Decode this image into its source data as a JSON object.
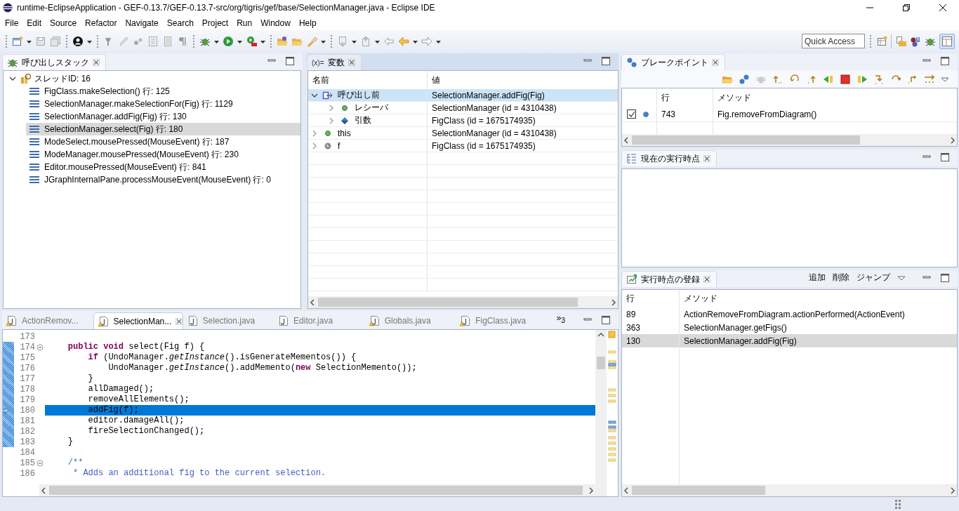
{
  "window": {
    "title": "runtime-EclipseApplication - GEF-0.13.7/GEF-0.13.7-src/org/tigris/gef/base/SelectionManager.java - Eclipse IDE"
  },
  "menu": [
    "File",
    "Edit",
    "Source",
    "Refactor",
    "Navigate",
    "Search",
    "Project",
    "Run",
    "Window",
    "Help"
  ],
  "quick_access": {
    "placeholder": "Quick Access"
  },
  "callstack": {
    "title": "呼び出しスタック",
    "active": false,
    "thread": {
      "label": "スレッドID: 16",
      "expanded": true,
      "frames": [
        {
          "label": "FigClass.makeSelection() 行: 125",
          "selected": false
        },
        {
          "label": "SelectionManager.makeSelectionFor(Fig) 行: 1129",
          "selected": false
        },
        {
          "label": "SelectionManager.addFig(Fig) 行: 130",
          "selected": false
        },
        {
          "label": "SelectionManager.select(Fig) 行: 180",
          "selected": true
        },
        {
          "label": "ModeSelect.mousePressed(MouseEvent) 行: 187",
          "selected": false
        },
        {
          "label": "ModeManager.mousePressed(MouseEvent) 行: 230",
          "selected": false
        },
        {
          "label": "Editor.mousePressed(MouseEvent) 行: 841",
          "selected": false
        },
        {
          "label": "JGraphInternalPane.processMouseEvent(MouseEvent) 行: 0",
          "selected": false
        }
      ]
    }
  },
  "variables": {
    "title": "変数",
    "icon_text": "(x)=",
    "active": true,
    "columns": [
      "名前",
      "値"
    ],
    "rows": [
      {
        "kind": "frame",
        "name": "呼び出し前",
        "value": "SelectionManager.addFig(Fig)",
        "expanded": true,
        "selected": true,
        "children": [
          {
            "kind": "field",
            "name": "レシーバ",
            "value": "SelectionManager (id = 4310438)",
            "expanded": false,
            "selected": false
          },
          {
            "kind": "argument",
            "name": "引数",
            "value": "FigClass (id = 1675174935)",
            "expanded": false,
            "selected": false
          }
        ]
      },
      {
        "kind": "field",
        "name": "this",
        "value": "SelectionManager (id = 4310438)",
        "expanded": false,
        "selected": false
      },
      {
        "kind": "local",
        "name": "f",
        "value": "FigClass (id = 1675174935)",
        "expanded": false,
        "selected": false
      }
    ]
  },
  "editor": {
    "tabs": [
      {
        "label": "ActionRemov...",
        "selected": false,
        "warning": true
      },
      {
        "label": "SelectionMan...",
        "selected": true,
        "warning": true
      },
      {
        "label": "Selection.java",
        "selected": false,
        "warning": false
      },
      {
        "label": "Editor.java",
        "selected": false,
        "warning": false
      },
      {
        "label": "Globals.java",
        "selected": false,
        "warning": true
      },
      {
        "label": "FigClass.java",
        "selected": false,
        "warning": true
      }
    ],
    "overflow": "»$_{3}$",
    "lines": [
      {
        "number": "173",
        "traced": false,
        "foldable": false,
        "current": false
      },
      {
        "number": "174",
        "traced": true,
        "foldable": true,
        "current": false,
        "tokens": [
          {
            "kind": "keyword",
            "text": "    public void"
          },
          {
            "kind": "plain",
            "text": " select(Fig f) {"
          }
        ]
      },
      {
        "number": "175",
        "traced": true,
        "foldable": false,
        "current": false,
        "tokens": [
          {
            "kind": "keyword",
            "text": "        if"
          },
          {
            "kind": "plain",
            "text": " (UndoManager."
          },
          {
            "kind": "static",
            "text": "getInstance"
          },
          {
            "kind": "plain",
            "text": "().isGenerateMementos()) {"
          }
        ]
      },
      {
        "number": "176",
        "traced": true,
        "foldable": false,
        "current": false,
        "tokens": [
          {
            "kind": "plain",
            "text": "            UndoManager."
          },
          {
            "kind": "static",
            "text": "getInstance"
          },
          {
            "kind": "plain",
            "text": "().addMemento("
          },
          {
            "kind": "keyword",
            "text": "new"
          },
          {
            "kind": "plain",
            "text": " SelectionMemento());"
          }
        ]
      },
      {
        "number": "177",
        "traced": true,
        "foldable": false,
        "current": false,
        "tokens": [
          {
            "kind": "plain",
            "text": "        }"
          }
        ]
      },
      {
        "number": "178",
        "traced": true,
        "foldable": false,
        "current": false,
        "tokens": [
          {
            "kind": "plain",
            "text": "        allDamaged();"
          }
        ]
      },
      {
        "number": "179",
        "traced": true,
        "foldable": false,
        "current": false,
        "tokens": [
          {
            "kind": "plain",
            "text": "        removeAllElements();"
          }
        ]
      },
      {
        "number": "180",
        "traced": true,
        "foldable": false,
        "current": true,
        "tokens": [
          {
            "kind": "plain",
            "text": "        addFig(f);"
          }
        ]
      },
      {
        "number": "181",
        "traced": true,
        "foldable": false,
        "current": false,
        "tokens": [
          {
            "kind": "plain",
            "text": "        editor.damageAll();"
          }
        ]
      },
      {
        "number": "182",
        "traced": true,
        "foldable": false,
        "current": false,
        "tokens": [
          {
            "kind": "plain",
            "text": "        fireSelectionChanged();"
          }
        ]
      },
      {
        "number": "183",
        "traced": true,
        "foldable": false,
        "current": false,
        "tokens": [
          {
            "kind": "plain",
            "text": "    }"
          }
        ]
      },
      {
        "number": "184",
        "traced": false,
        "foldable": false,
        "current": false
      },
      {
        "number": "185",
        "traced": false,
        "foldable": true,
        "current": false,
        "tokens": [
          {
            "kind": "doc",
            "text": "    /**"
          }
        ]
      },
      {
        "number": "186",
        "traced": false,
        "foldable": false,
        "current": false,
        "tokens": [
          {
            "kind": "doc",
            "text": "     * Adds an additional fig to the current selection."
          }
        ]
      }
    ]
  },
  "breakpoints": {
    "title": "ブレークポイント",
    "active": false,
    "columns": [
      "行",
      "メソッド"
    ],
    "rows": [
      {
        "enabled": true,
        "line": "743",
        "method": "Fig.removeFromDiagram()"
      }
    ]
  },
  "current_point": {
    "title": "現在の実行時点",
    "active": false
  },
  "registry": {
    "title": "実行時点の登録",
    "active": false,
    "actions": [
      "追加",
      "削除",
      "ジャンプ"
    ],
    "columns": [
      "行",
      "メソッド"
    ],
    "rows": [
      {
        "line": "89",
        "method": "ActionRemoveFromDiagram.actionPerformed(ActionEvent)",
        "selected": false
      },
      {
        "line": "363",
        "method": "SelectionManager.getFigs()",
        "selected": false
      },
      {
        "line": "130",
        "method": "SelectionManager.addFig(Fig)",
        "selected": true
      }
    ]
  }
}
